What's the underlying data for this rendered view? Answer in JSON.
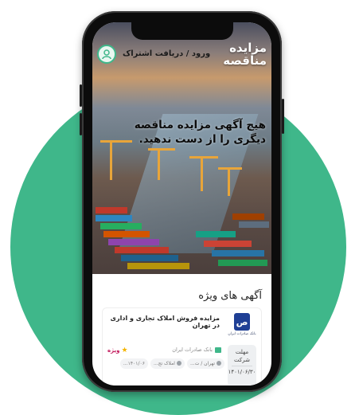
{
  "header": {
    "login_label": "ورود / دریافت اشتراک",
    "logo_line1": "مزایده",
    "logo_line2": "مناقصه"
  },
  "hero": {
    "headline": "هیچ آگهی مزایده مناقصه دیگری را از دست ندهید."
  },
  "featured": {
    "section_title": "آگهی های ویژه",
    "card": {
      "title": "مزایده فروش املاک تجاری و اداری در تهران",
      "organization": "بانک صادرات ایران",
      "bank_mark": "ص",
      "bank_caption": "بانک صادرات ایران",
      "vip_label": "ویژه",
      "deadline_label": "مهلت شرکت",
      "deadline_date": "۱۴۰۱/۰۶/۳۰",
      "chips": [
        "تهران / ت...",
        "املاک تج...",
        "۱۴۰۱/۰۶..."
      ]
    }
  },
  "colors": {
    "accent": "#3fb78a",
    "bank_blue": "#1f3f95",
    "vip": "#c2185b"
  }
}
